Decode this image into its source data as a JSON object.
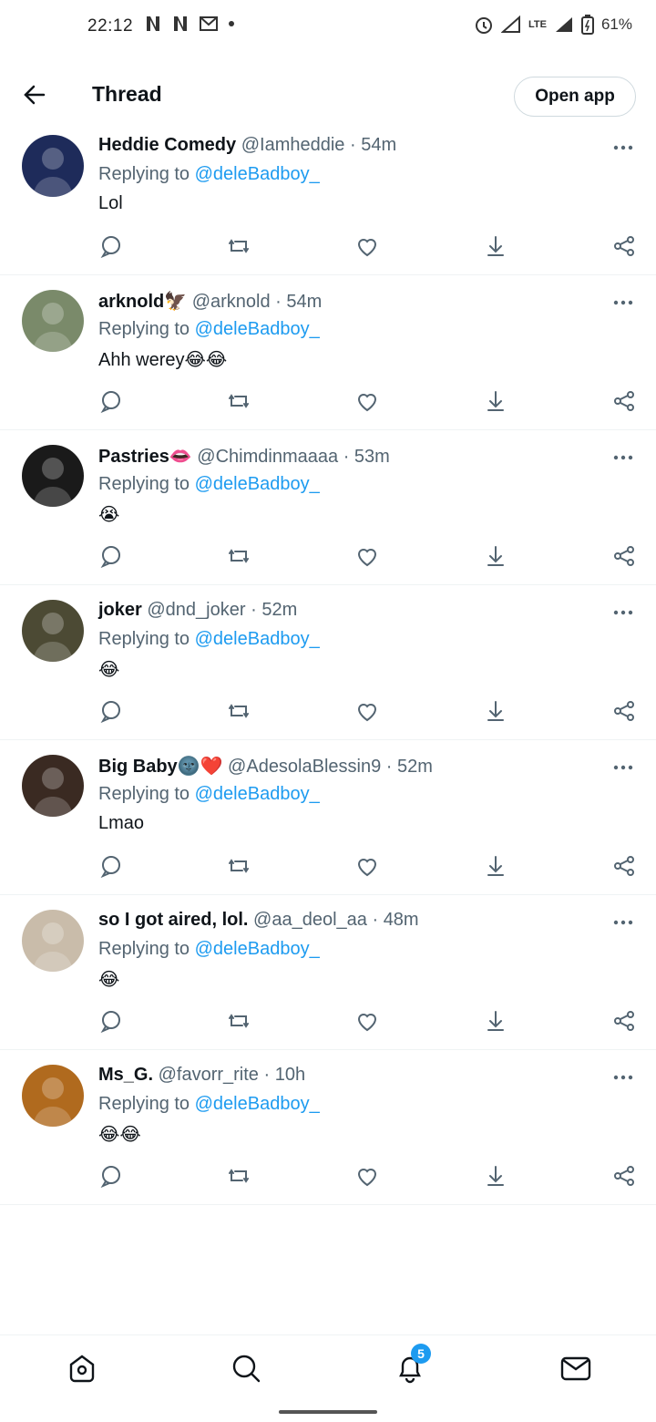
{
  "status_bar": {
    "time": "22:12",
    "network": "LTE",
    "battery": "61%"
  },
  "header": {
    "title": "Thread",
    "open_app": "Open app"
  },
  "tweets": [
    {
      "name": "Heddie Comedy",
      "handle": "@Iamheddie",
      "time": "54m",
      "replying_prefix": "Replying to",
      "replying_to": "@deleBadboy_",
      "text": "Lol",
      "avatar_color": "#1e2b5a"
    },
    {
      "name": "arknold🦅",
      "handle": "@arknold",
      "time": "54m",
      "replying_prefix": "Replying to",
      "replying_to": "@deleBadboy_",
      "text": "Ahh werey😂😂",
      "avatar_color": "#7a8a6a"
    },
    {
      "name": "Pastries👄",
      "handle": "@Chimdinmaaaa",
      "time": "53m",
      "replying_prefix": "Replying to",
      "replying_to": "@deleBadboy_",
      "text": "😭",
      "avatar_color": "#1a1a1a"
    },
    {
      "name": "joker",
      "handle": "@dnd_joker",
      "time": "52m",
      "replying_prefix": "Replying to",
      "replying_to": "@deleBadboy_",
      "text": "😂",
      "avatar_color": "#4c4a34"
    },
    {
      "name": "Big Baby🌚❤️",
      "handle": "@AdesolaBlessin9",
      "time": "52m",
      "replying_prefix": "Replying to",
      "replying_to": "@deleBadboy_",
      "text": "Lmao",
      "avatar_color": "#3a2a22"
    },
    {
      "name": "so I got aired, lol.",
      "handle": "@aa_deol_aa",
      "time": "48m",
      "replying_prefix": "Replying to",
      "replying_to": "@deleBadboy_",
      "text": "😂",
      "avatar_color": "#c9bcaa"
    },
    {
      "name": "Ms_G.",
      "handle": "@favorr_rite",
      "time": "10h",
      "replying_prefix": "Replying to",
      "replying_to": "@deleBadboy_",
      "text": "😂😂",
      "avatar_color": "#b06a1e"
    }
  ],
  "nav": {
    "notifications_count": "5"
  },
  "colors": {
    "accent": "#1d9bf0",
    "secondary_text": "#536471"
  }
}
